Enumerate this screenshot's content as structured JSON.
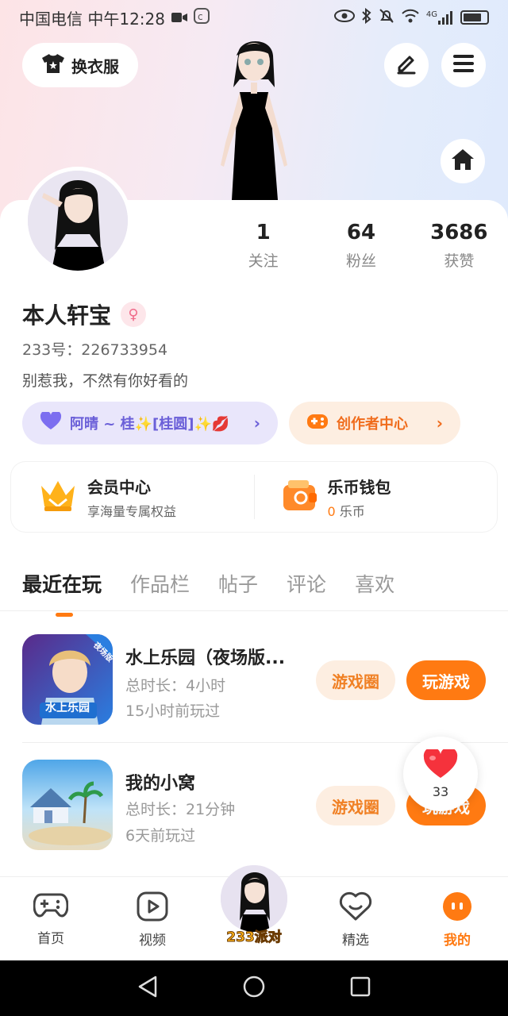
{
  "status_bar": {
    "carrier": "中国电信 中午12:28",
    "network": "4G"
  },
  "header": {
    "dress_label": "换衣服",
    "edit_icon": "pencil-icon",
    "menu_icon": "hamburger-icon",
    "home_icon": "home-icon"
  },
  "profile": {
    "stats": [
      {
        "value": "1",
        "label": "关注"
      },
      {
        "value": "64",
        "label": "粉丝"
      },
      {
        "value": "3686",
        "label": "获赞"
      }
    ],
    "name": "本人轩宝",
    "gender_symbol": "♀",
    "id_line": "233号：226733954",
    "bio": "别惹我，不然有你好看的",
    "relation_tag": "阿晴 ~ 桂✨[桂圆]✨💋",
    "creator_center": "创作者中心"
  },
  "vip": {
    "member_title": "会员中心",
    "member_sub": "享海量专属权益",
    "wallet_title": "乐币钱包",
    "wallet_amount": "0",
    "wallet_unit": "乐币"
  },
  "tabs": [
    "最近在玩",
    "作品栏",
    "帖子",
    "评论",
    "喜欢"
  ],
  "games": [
    {
      "title": "水上乐园（夜场版...",
      "duration": "总时长：4小时",
      "last_played": "15小时前玩过",
      "icon_badge": "夜场版",
      "icon_caption": "水上乐园"
    },
    {
      "title": "我的小窝",
      "duration": "总时长：21分钟",
      "last_played": "6天前玩过"
    }
  ],
  "game_buttons": {
    "circle": "游戏圈",
    "play": "玩游戏"
  },
  "like_float": {
    "count": "33"
  },
  "bottom_nav": [
    {
      "label": "首页",
      "icon": "gamepad-icon"
    },
    {
      "label": "视频",
      "icon": "video-play-icon"
    },
    {
      "label": "233派对",
      "icon": "party-avatar"
    },
    {
      "label": "精选",
      "icon": "heart-chat-icon"
    },
    {
      "label": "我的",
      "icon": "me-face-icon"
    }
  ],
  "colors": {
    "accent": "#ff7a12",
    "tag_purple": "#6a5fd8"
  }
}
